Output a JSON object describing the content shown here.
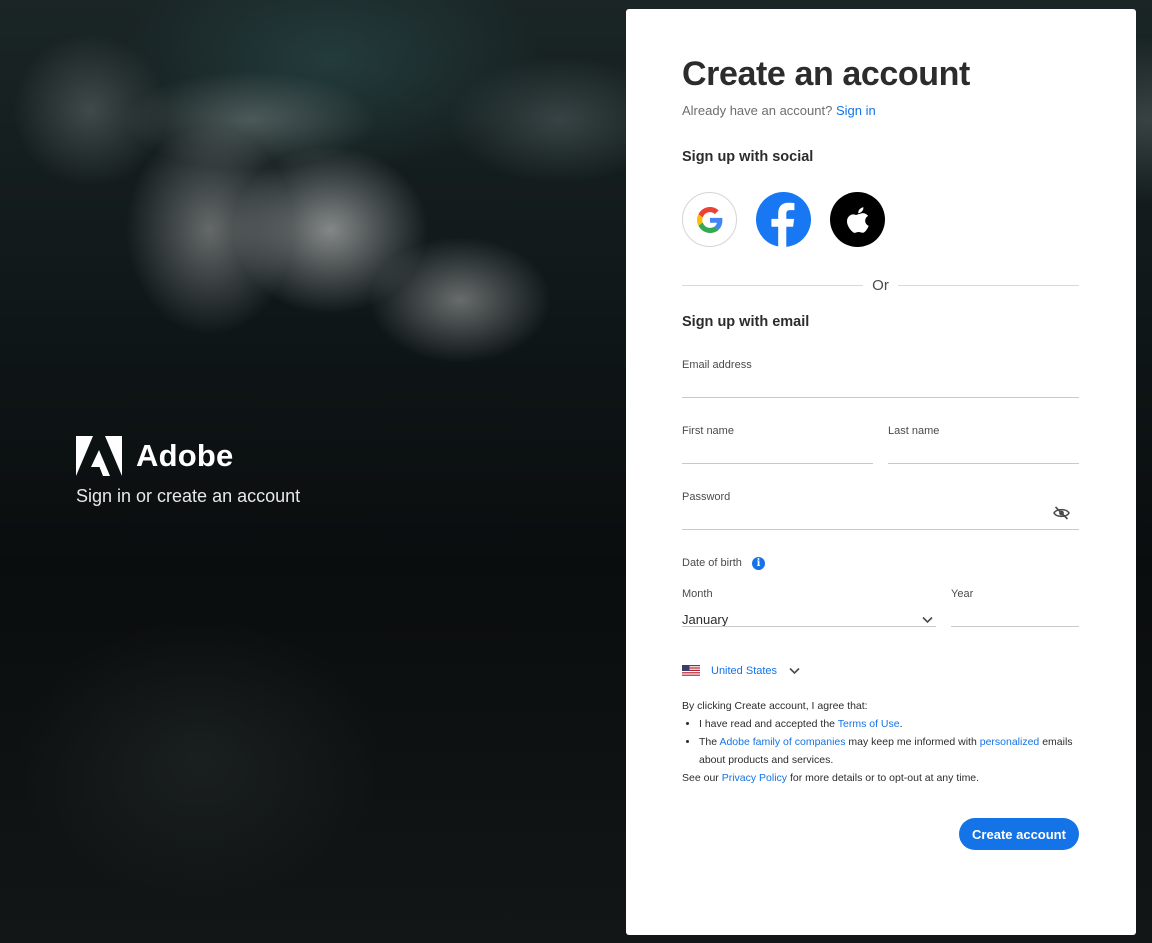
{
  "brand": {
    "name": "Adobe",
    "tagline": "Sign in or create an account"
  },
  "form": {
    "title": "Create an account",
    "signin_prompt": "Already have an account?",
    "signin_link": "Sign in",
    "social_heading": "Sign up with social",
    "social": [
      {
        "name": "Google",
        "icon": "google-icon"
      },
      {
        "name": "Facebook",
        "icon": "facebook-icon",
        "color": "#1877F2"
      },
      {
        "name": "Apple",
        "icon": "apple-icon",
        "color": "#000000"
      }
    ],
    "divider_text": "Or",
    "email_heading": "Sign up with email",
    "email_label": "Email address",
    "email_value": "",
    "first_name_label": "First name",
    "first_name_value": "",
    "last_name_label": "Last name",
    "last_name_value": "",
    "password_label": "Password",
    "password_value": "",
    "password_toggle_icon": "eye-off-icon",
    "dob_label": "Date of birth",
    "dob_info_icon": "info-icon",
    "month_label": "Month",
    "month_value": "January",
    "year_label": "Year",
    "year_value": "",
    "country": "United States",
    "country_flag_icon": "us-flag-icon"
  },
  "terms": {
    "intro": "By clicking Create account, I agree that:",
    "bullet1_pre": "I have read and accepted the ",
    "bullet1_link": "Terms of Use",
    "bullet1_post": ".",
    "bullet2_pre": "The ",
    "bullet2_link": "Adobe family of companies",
    "bullet2_mid": " may keep me informed with ",
    "bullet2_link2": "personalized",
    "bullet2_post": " emails about products and services.",
    "outro_pre": "See our ",
    "outro_link": "Privacy Policy",
    "outro_post": " for more details or to opt-out at any time."
  },
  "cta": {
    "label": "Create account"
  },
  "colors": {
    "accent": "#1473E6",
    "facebook": "#1877F2",
    "text": "#2C2C2C"
  }
}
